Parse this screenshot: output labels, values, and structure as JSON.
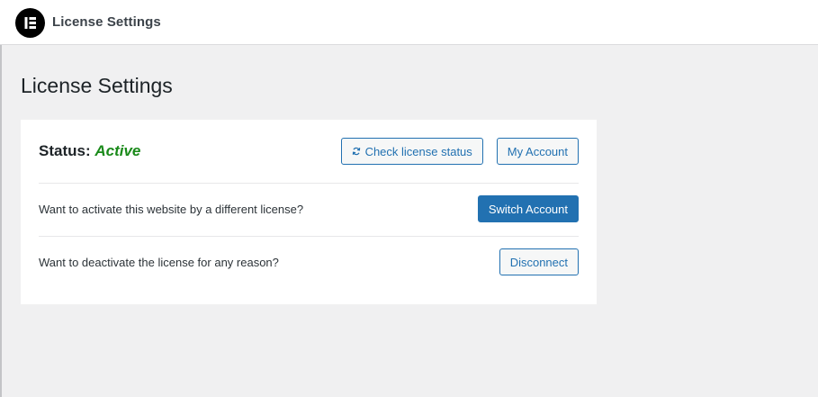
{
  "topbar": {
    "logo_icon": "elementor-logo-icon",
    "title": "License Settings"
  },
  "page": {
    "title": "License Settings"
  },
  "license": {
    "status_label": "Status:",
    "status_value": "Active",
    "status_color": "#1a8a1a",
    "check_status_icon": "refresh-icon",
    "check_status_label": "Check license status",
    "my_account_label": "My Account",
    "switch_prompt": "Want to activate this website by a different license?",
    "switch_label": "Switch Account",
    "deactivate_prompt": "Want to deactivate the license for any reason?",
    "disconnect_label": "Disconnect"
  },
  "colors": {
    "accent": "#2271b1",
    "background": "#f0f0f1"
  }
}
